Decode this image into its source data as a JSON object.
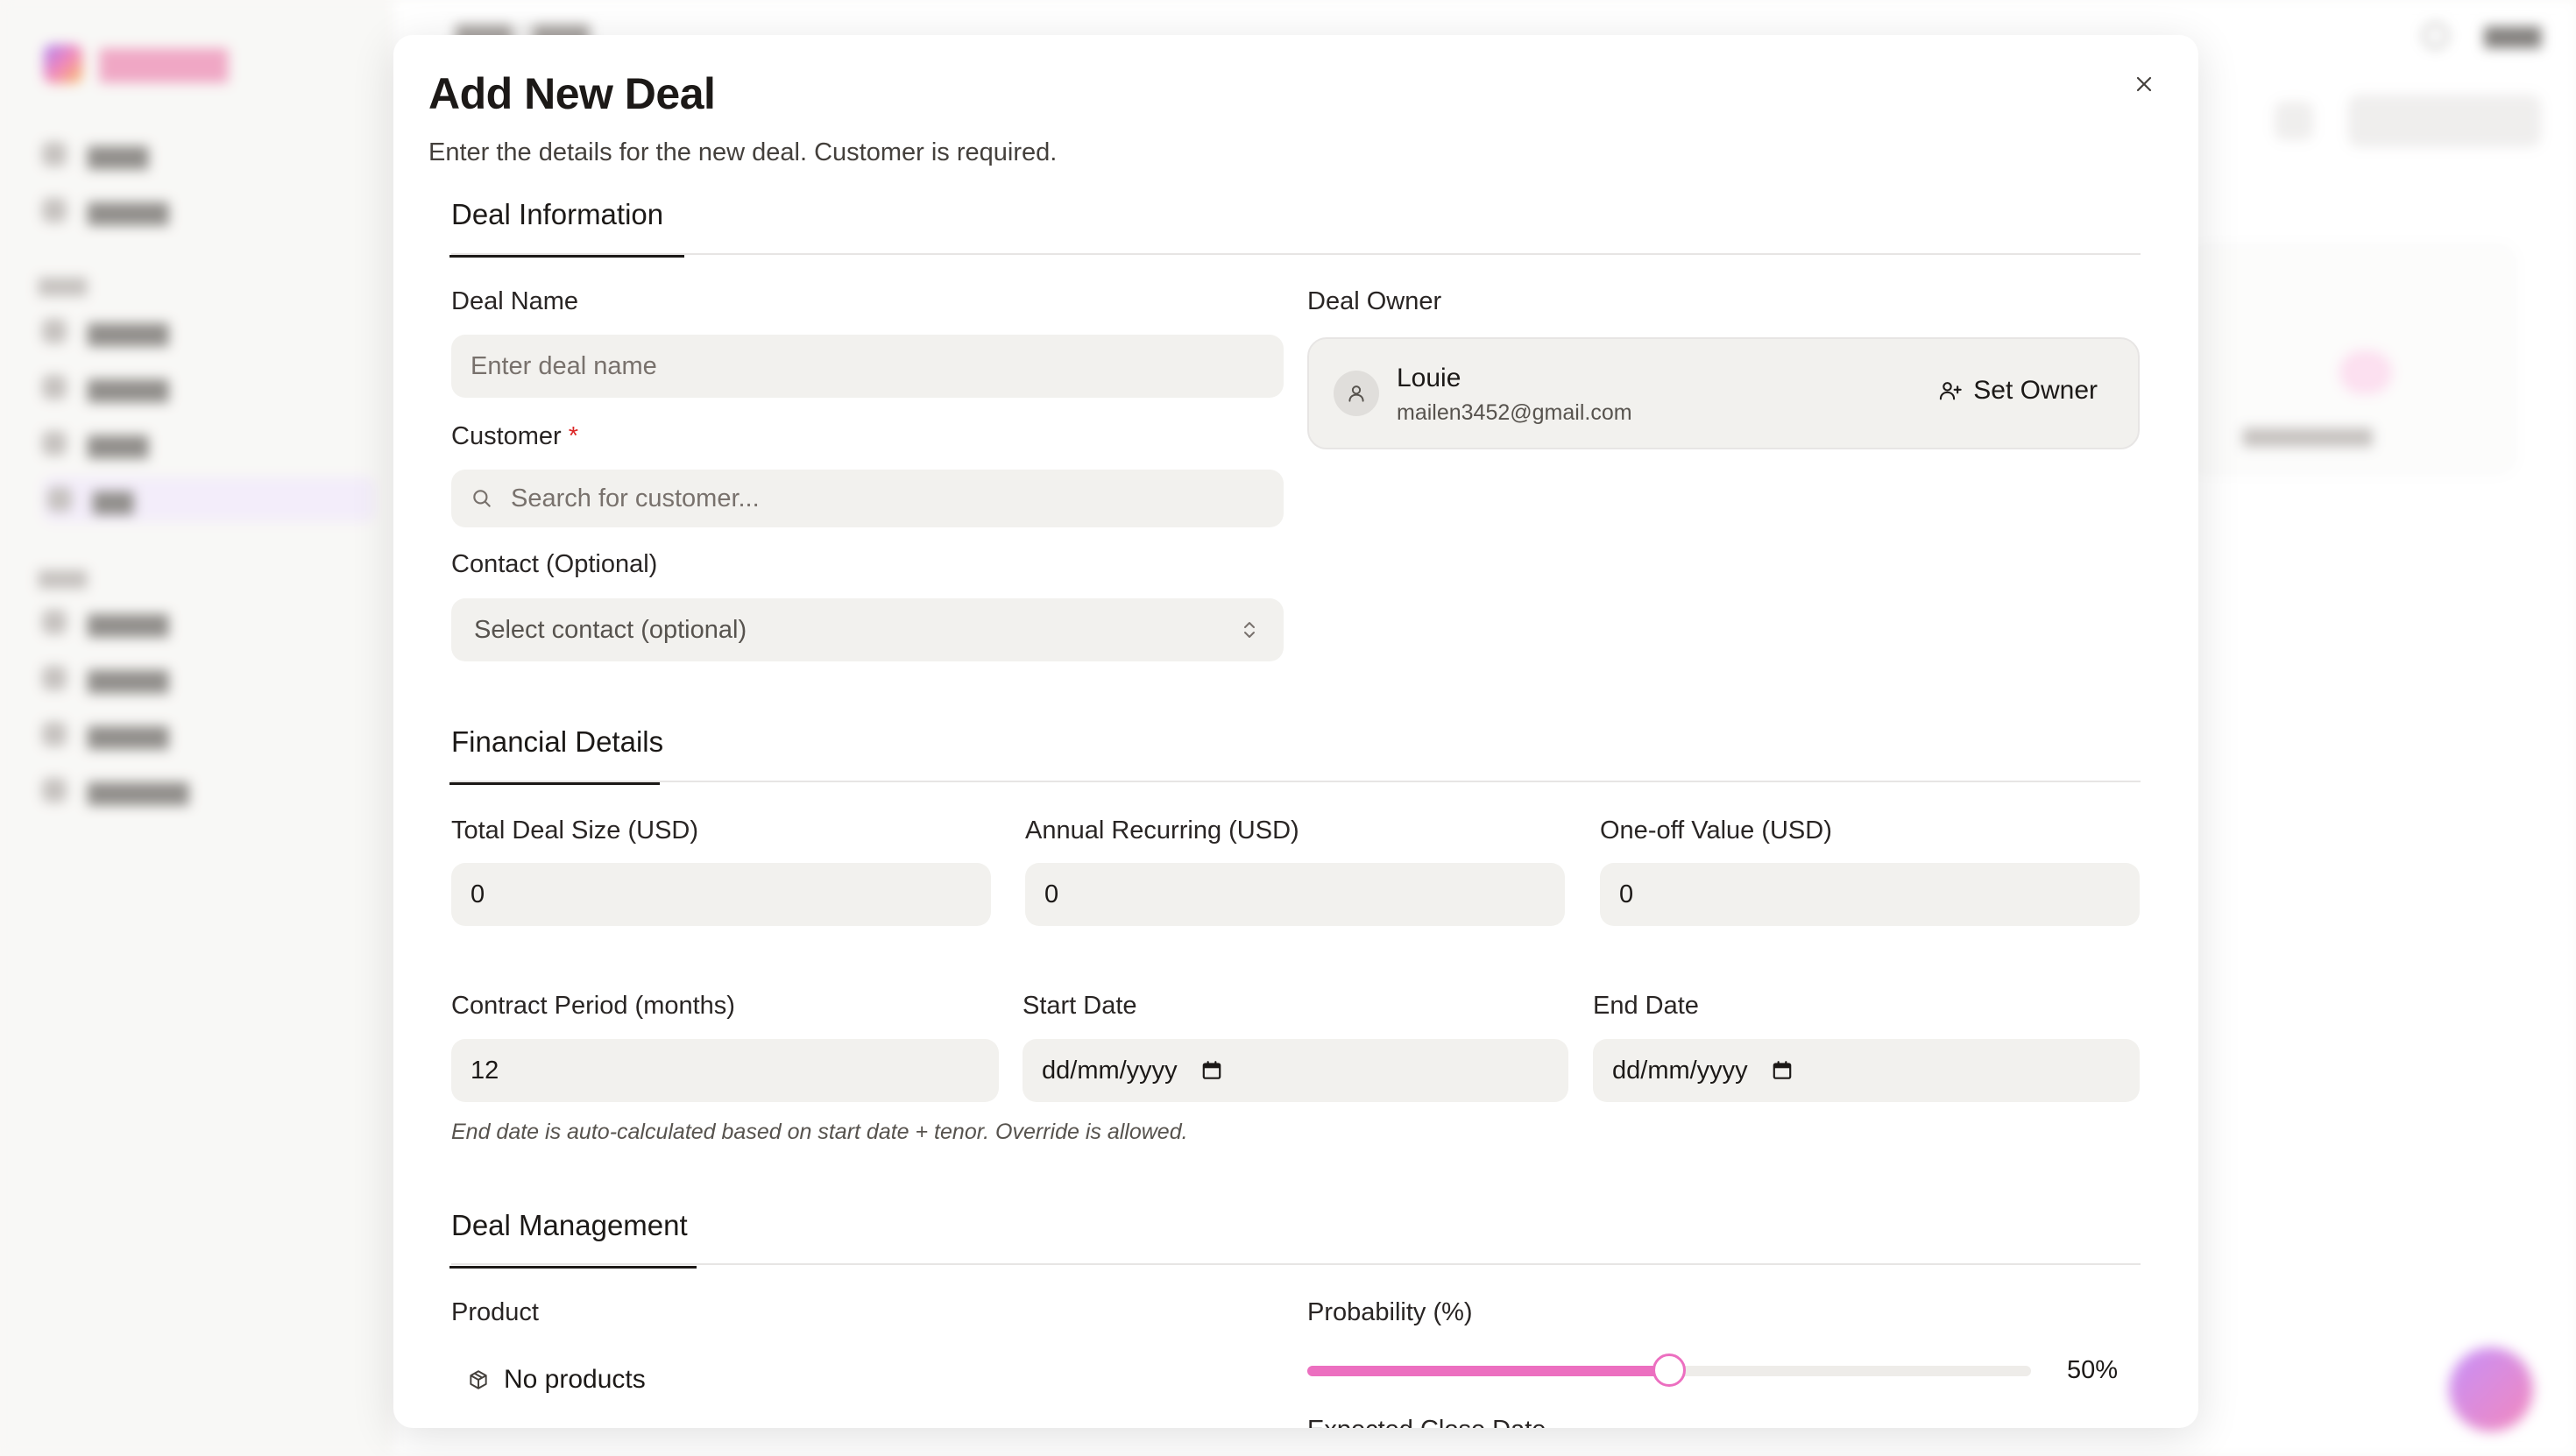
{
  "modal": {
    "title": "Add New Deal",
    "subtitle": "Enter the details for the new deal. Customer is required.",
    "close_icon": "x-icon"
  },
  "sections": {
    "deal_info": "Deal Information",
    "financial": "Financial Details",
    "management": "Deal Management"
  },
  "deal_info": {
    "deal_name_label": "Deal Name",
    "deal_name_placeholder": "Enter deal name",
    "customer_label": "Customer",
    "customer_required_mark": "*",
    "customer_placeholder": "Search for customer...",
    "contact_label": "Contact (Optional)",
    "contact_value": "Select contact (optional)",
    "owner_label": "Deal Owner",
    "owner_name": "Louie",
    "owner_email": "mailen3452@gmail.com",
    "set_owner_label": "Set Owner"
  },
  "financial": {
    "total_label": "Total Deal Size (USD)",
    "total_value": "0",
    "annual_label": "Annual Recurring (USD)",
    "annual_value": "0",
    "oneoff_label": "One-off Value (USD)",
    "oneoff_value": "0",
    "contract_label": "Contract Period (months)",
    "contract_value": "12",
    "start_label": "Start Date",
    "start_placeholder": "dd/mm/yyyy",
    "end_label": "End Date",
    "end_placeholder": "dd/mm/yyyy",
    "hint": "End date is auto-calculated based on start date + tenor. Override is allowed."
  },
  "management": {
    "product_label": "Product",
    "no_products": "No products",
    "probability_label": "Probability (%)",
    "probability_value": 50,
    "probability_text": "50%",
    "next_label_partial": "Expected Close Date"
  },
  "colors": {
    "accent": "#ec6fc0",
    "required": "#dc2626",
    "input_bg": "#f2f1ee"
  }
}
